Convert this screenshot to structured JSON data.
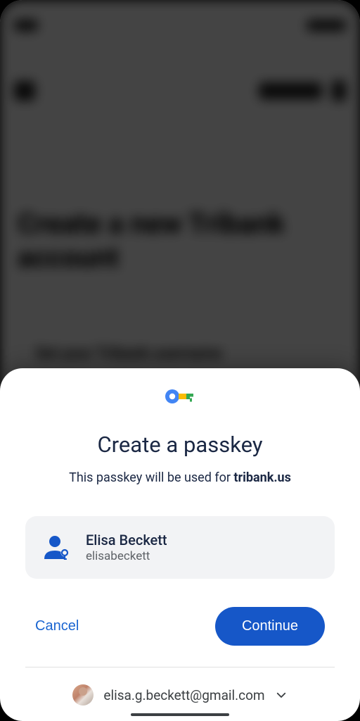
{
  "backdrop": {
    "heading_line1": "Create a new Tribank",
    "heading_line2": "account",
    "label": "Set your Tribank username"
  },
  "sheet": {
    "title": "Create a passkey",
    "subtitle_prefix": "This passkey will be used for ",
    "subtitle_domain": "tribank.us",
    "account_name": "Elisa Beckett",
    "account_username": "elisabeckett",
    "cancel_label": "Cancel",
    "continue_label": "Continue",
    "footer_email": "elisa.g.beckett@gmail.com"
  },
  "colors": {
    "primary": "#1657c8",
    "link": "#1a65d1",
    "text_dark": "#1b2844"
  }
}
